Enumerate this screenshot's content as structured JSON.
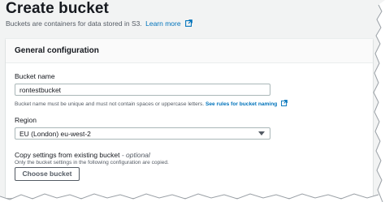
{
  "header": {
    "title": "Create bucket",
    "description": "Buckets are containers for data stored in S3.",
    "learn_more": "Learn more"
  },
  "panel": {
    "title": "General configuration",
    "bucket_name": {
      "label": "Bucket name",
      "value": "rontestbucket",
      "hint": "Bucket name must be unique and must not contain spaces or uppercase letters.",
      "hint_link": "See rules for bucket naming"
    },
    "region": {
      "label": "Region",
      "value": "EU (London) eu-west-2"
    },
    "copy_settings": {
      "label": "Copy settings from existing bucket",
      "label_suffix": "- optional",
      "hint": "Only the bucket settings in the following configuration are copied.",
      "button": "Choose bucket"
    }
  },
  "colors": {
    "link": "#0073bb",
    "text": "#16191f",
    "secondary_text": "#545b64",
    "border": "#aab7b8"
  },
  "icons": [
    "external-link-icon",
    "dropdown-caret-icon"
  ]
}
